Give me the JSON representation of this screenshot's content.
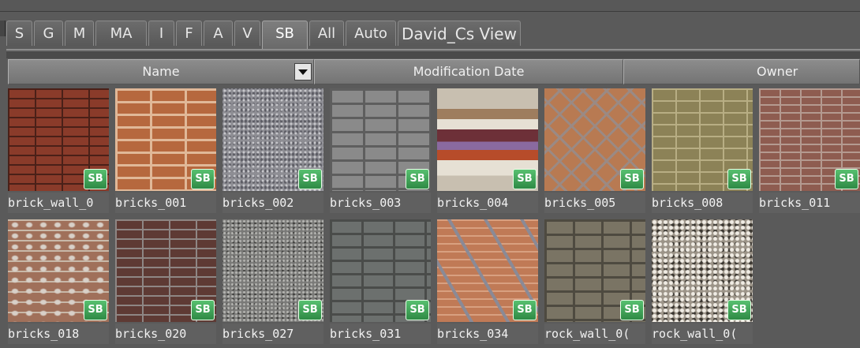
{
  "tabs": [
    {
      "label": "S",
      "active": false
    },
    {
      "label": "G",
      "active": false
    },
    {
      "label": "M",
      "active": false
    },
    {
      "label": "MA",
      "active": false
    },
    {
      "label": "I",
      "active": false
    },
    {
      "label": "F",
      "active": false
    },
    {
      "label": "A",
      "active": false
    },
    {
      "label": "V",
      "active": false
    },
    {
      "label": "SB",
      "active": true
    },
    {
      "label": "All",
      "active": false
    },
    {
      "label": "Auto",
      "active": false
    },
    {
      "label": "David_Cs View",
      "active": false
    }
  ],
  "columns": {
    "name": "Name",
    "date": "Modification Date",
    "owner": "Owner"
  },
  "items": [
    {
      "name": "brick_wall_0",
      "badge": "SB",
      "texture": "brick-red"
    },
    {
      "name": "bricks_001",
      "badge": "SB",
      "texture": "brick-orange"
    },
    {
      "name": "bricks_002",
      "badge": "SB",
      "texture": "gravel"
    },
    {
      "name": "bricks_003",
      "badge": "SB",
      "texture": "stone-grey"
    },
    {
      "name": "bricks_004",
      "badge": "SB",
      "texture": "tile"
    },
    {
      "name": "bricks_005",
      "badge": "SB",
      "texture": "herring"
    },
    {
      "name": "bricks_008",
      "badge": "SB",
      "texture": "olive"
    },
    {
      "name": "bricks_011",
      "badge": "SB",
      "texture": "brick-dusty"
    },
    {
      "name": "bricks_018",
      "badge": "SB",
      "texture": "brick-white"
    },
    {
      "name": "bricks_020",
      "badge": "SB",
      "texture": "brick-dark"
    },
    {
      "name": "bricks_027",
      "badge": "SB",
      "texture": "granite"
    },
    {
      "name": "bricks_031",
      "badge": "SB",
      "texture": "stone-dark"
    },
    {
      "name": "bricks_034",
      "badge": "SB",
      "texture": "brick-diag"
    },
    {
      "name": "rock_wall_0(",
      "badge": "SB",
      "texture": "rock"
    },
    {
      "name": "rock_wall_0(",
      "badge": "SB",
      "texture": "pebble"
    }
  ]
}
